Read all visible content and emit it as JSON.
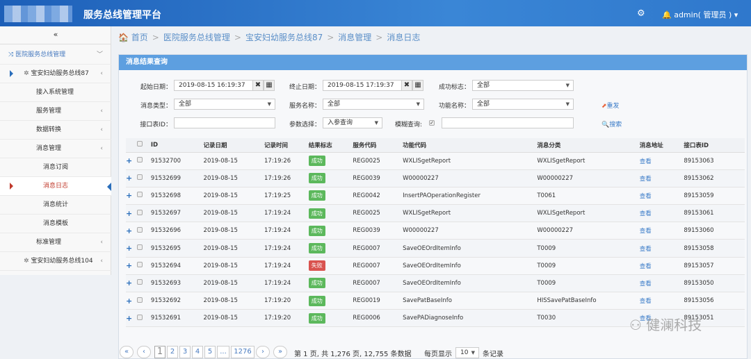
{
  "header": {
    "title": "服务总线管理平台",
    "user": "admin( 管理员 )"
  },
  "sidebar": {
    "collapse": "«",
    "items": [
      {
        "label": "医院服务总线管理",
        "level": 0,
        "chev": "﹀"
      },
      {
        "label": "宝安妇幼服务总线87",
        "level": 1,
        "chev": "‹"
      },
      {
        "label": "接入系统管理",
        "level": 2,
        "chev": ""
      },
      {
        "label": "服务管理",
        "level": 2,
        "chev": "‹"
      },
      {
        "label": "数据转换",
        "level": 2,
        "chev": "‹"
      },
      {
        "label": "消息管理",
        "level": 2,
        "chev": "‹"
      },
      {
        "label": "消息订阅",
        "level": 3,
        "chev": ""
      },
      {
        "label": "消息日志",
        "level": 3,
        "chev": "",
        "active": true
      },
      {
        "label": "消息统计",
        "level": 3,
        "chev": ""
      },
      {
        "label": "消息模板",
        "level": 3,
        "chev": ""
      },
      {
        "label": "标准管理",
        "level": 2,
        "chev": "‹"
      },
      {
        "label": "宝安妇幼服务总线104",
        "level": 1,
        "chev": "‹"
      }
    ]
  },
  "breadcrumb": [
    "首页",
    "医院服务总线管理",
    "宝安妇幼服务总线87",
    "消息管理",
    "消息日志"
  ],
  "panel": {
    "title": "消息结果查询"
  },
  "filters": {
    "start_label": "起始日期：",
    "start_value": "2019-08-15 16:19:37",
    "end_label": "终止日期：",
    "end_value": "2019-08-15 17:19:37",
    "success_label": "成功标志：",
    "success_value": "全部",
    "msgtype_label": "消息类型：",
    "msgtype_value": "全部",
    "service_label": "服务名称：",
    "service_value": "全部",
    "func_label": "功能名称：",
    "func_value": "全部",
    "ifid_label": "接口表ID：",
    "ifid_value": "",
    "param_label": "参数选择：",
    "param_value": "入参查询",
    "fuzzy_label": "模糊查询:",
    "fuzzy_checked": true,
    "fuzzy_value": "",
    "reset": "重发",
    "search": "搜索"
  },
  "table": {
    "columns": [
      "ID",
      "记录日期",
      "记录时间",
      "结果标志",
      "服务代码",
      "功能代码",
      "消息分类",
      "消息地址",
      "接口表ID"
    ],
    "rows": [
      [
        "91532700",
        "2019-08-15",
        "17:19:26",
        "成功",
        "REG0025",
        "WXLISgetReport",
        "WXLISgetReport",
        "查看",
        "89153063"
      ],
      [
        "91532699",
        "2019-08-15",
        "17:19:26",
        "成功",
        "REG0039",
        "W00000227",
        "W00000227",
        "查看",
        "89153062"
      ],
      [
        "91532698",
        "2019-08-15",
        "17:19:25",
        "成功",
        "REG0042",
        "InsertPAOperationRegister",
        "T0061",
        "查看",
        "89153059"
      ],
      [
        "91532697",
        "2019-08-15",
        "17:19:24",
        "成功",
        "REG0025",
        "WXLISgetReport",
        "WXLISgetReport",
        "查看",
        "89153061"
      ],
      [
        "91532696",
        "2019-08-15",
        "17:19:24",
        "成功",
        "REG0039",
        "W00000227",
        "W00000227",
        "查看",
        "89153060"
      ],
      [
        "91532695",
        "2019-08-15",
        "17:19:24",
        "成功",
        "REG0007",
        "SaveOEOrdItemInfo",
        "T0009",
        "查看",
        "89153058"
      ],
      [
        "91532694",
        "2019-08-15",
        "17:19:24",
        "失败",
        "REG0007",
        "SaveOEOrdItemInfo",
        "T0009",
        "查看",
        "89153057"
      ],
      [
        "91532693",
        "2019-08-15",
        "17:19:24",
        "成功",
        "REG0007",
        "SaveOEOrdItemInfo",
        "T0009",
        "查看",
        "89153050"
      ],
      [
        "91532692",
        "2019-08-15",
        "17:19:20",
        "成功",
        "REG0019",
        "SavePatBaseInfo",
        "HISSavePatBaseInfo",
        "查看",
        "89153056"
      ],
      [
        "91532691",
        "2019-08-15",
        "17:19:20",
        "成功",
        "REG0006",
        "SavePADiagnoseInfo",
        "T0030",
        "查看",
        "89153051"
      ]
    ]
  },
  "colors": {
    "success": "#5cb85c",
    "fail": "#d9534f",
    "header": "#2b6cc4"
  },
  "pagination": {
    "pages": [
      "«",
      "‹",
      "1",
      "2",
      "3",
      "4",
      "5",
      "...",
      "1276",
      "›",
      "»"
    ],
    "current": "1",
    "info": "第 1 页, 共 1,276 页,  12,755 条数据",
    "per_page_label": "每页显示",
    "per_page": "10",
    "records_label": "条记录"
  },
  "watermark": "健澜科技"
}
